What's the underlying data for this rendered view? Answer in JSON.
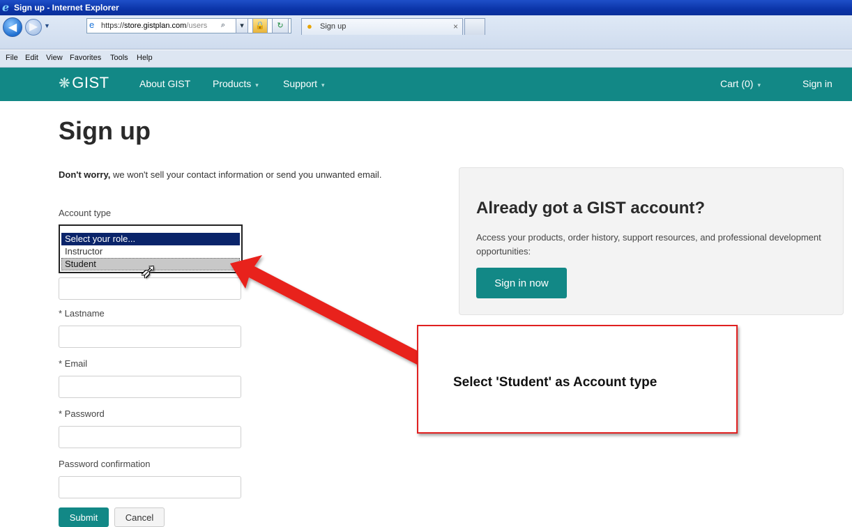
{
  "window": {
    "title": "Sign up - Internet Explorer"
  },
  "browser": {
    "url_proto": "https://",
    "url_host": "store.gistplan.com",
    "url_rest": "/users",
    "tab_title": "Sign up",
    "tab_close": "×"
  },
  "menu": [
    "File",
    "Edit",
    "View",
    "Favorites",
    "Tools",
    "Help"
  ],
  "site_nav": {
    "brand": "GIST",
    "about": "About GIST",
    "products": "Products",
    "support": "Support",
    "cart": "Cart (0)",
    "signin": "Sign in",
    "caret": "▾"
  },
  "page": {
    "title": "Sign up",
    "intro_bold": "Don't worry,",
    "intro_rest": " we won't sell your contact information or send you unwanted email.",
    "account_type_label": "Account type",
    "role_options": [
      "Select your role...",
      "Instructor",
      "Student"
    ],
    "lastname_label": "* Lastname",
    "email_label": "* Email",
    "password_label": "* Password",
    "password_confirm_label": "Password confirmation",
    "submit": "Submit",
    "cancel": "Cancel"
  },
  "panel": {
    "title": "Already got a GIST account?",
    "text": "Access your products, order history, support resources, and professional development opportunities:",
    "button": "Sign in now"
  },
  "annotation": {
    "text": "Select 'Student' as Account type",
    "color": "#e02020"
  },
  "colors": {
    "brand_teal": "#128886",
    "ie_title_blue": "#0b34a8",
    "selected_option": "#0a246a"
  },
  "icons": {
    "brand": "gist-logo-icon",
    "cursor": "mouse-pointer-icon"
  }
}
